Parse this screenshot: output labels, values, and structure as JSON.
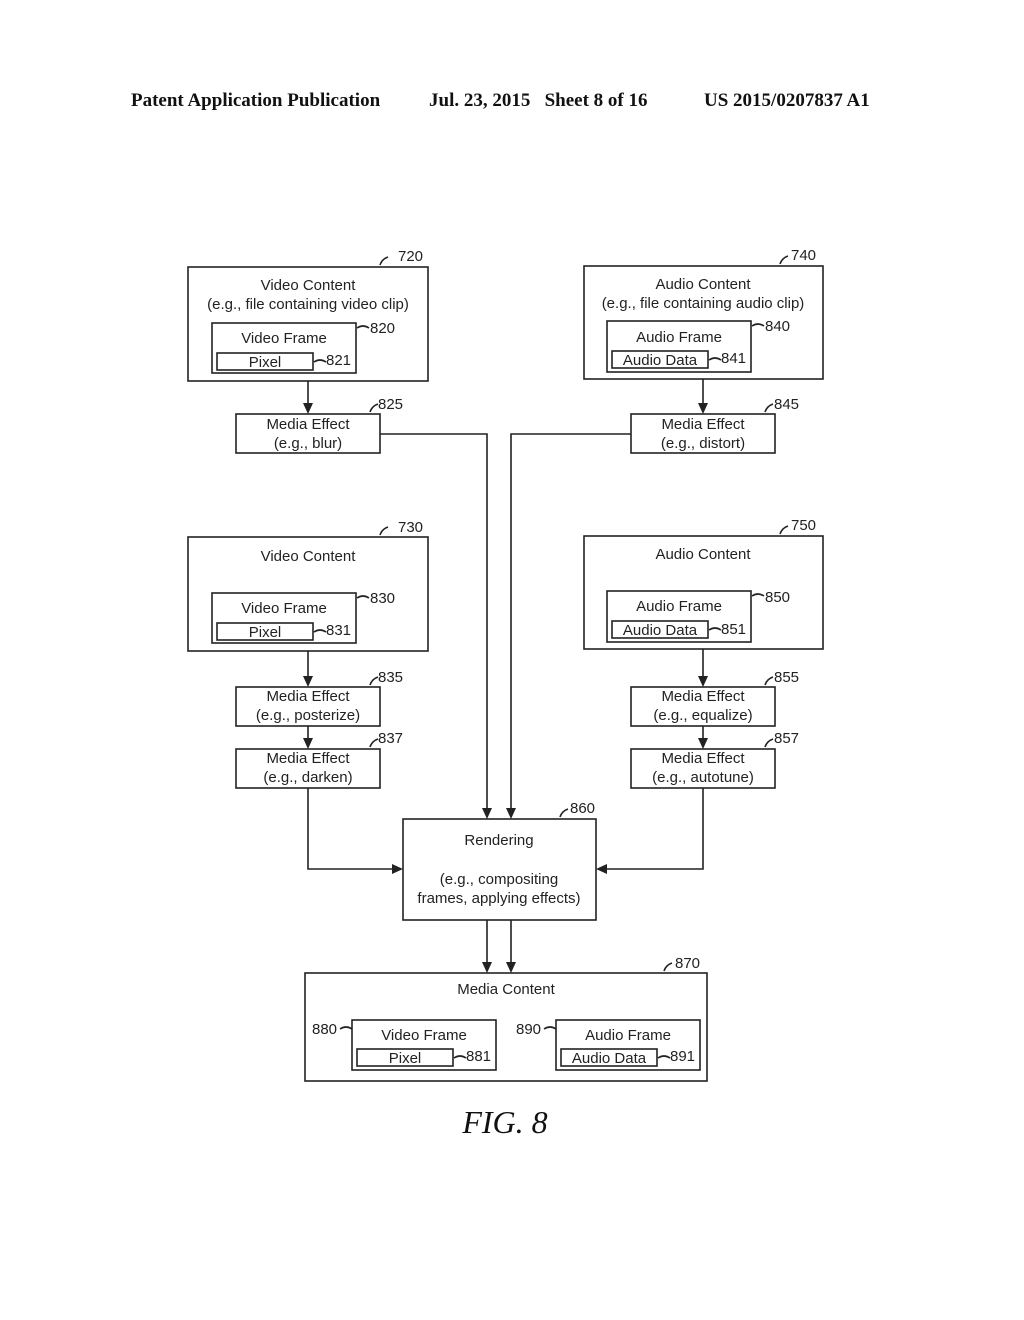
{
  "header": {
    "publication": "Patent Application Publication",
    "date_sheet": "Jul. 23, 2015   Sheet 8 of 16",
    "number": "US 2015/0207837 A1"
  },
  "figure_label": "FIG. 8",
  "nodes": {
    "n720": {
      "ref": "720",
      "line1": "Video Content",
      "line2": "(e.g., file containing video clip)"
    },
    "n820": {
      "ref": "820",
      "label": "Video Frame"
    },
    "n821": {
      "ref": "821",
      "label": "Pixel"
    },
    "n825": {
      "ref": "825",
      "line1": "Media Effect",
      "line2": "(e.g., blur)"
    },
    "n740": {
      "ref": "740",
      "line1": "Audio Content",
      "line2": "(e.g., file containing audio clip)"
    },
    "n840": {
      "ref": "840",
      "label": "Audio Frame"
    },
    "n841": {
      "ref": "841",
      "label": "Audio Data"
    },
    "n845": {
      "ref": "845",
      "line1": "Media Effect",
      "line2": "(e.g., distort)"
    },
    "n730": {
      "ref": "730",
      "line1": "Video Content"
    },
    "n830": {
      "ref": "830",
      "label": "Video Frame"
    },
    "n831": {
      "ref": "831",
      "label": "Pixel"
    },
    "n835": {
      "ref": "835",
      "line1": "Media Effect",
      "line2": "(e.g., posterize)"
    },
    "n837": {
      "ref": "837",
      "line1": "Media Effect",
      "line2": "(e.g., darken)"
    },
    "n750": {
      "ref": "750",
      "line1": "Audio Content"
    },
    "n850": {
      "ref": "850",
      "label": "Audio Frame"
    },
    "n851": {
      "ref": "851",
      "label": "Audio Data"
    },
    "n855": {
      "ref": "855",
      "line1": "Media Effect",
      "line2": "(e.g., equalize)"
    },
    "n857": {
      "ref": "857",
      "line1": "Media Effect",
      "line2": "(e.g., autotune)"
    },
    "n860": {
      "ref": "860",
      "line1": "Rendering",
      "line2": "(e.g., compositing",
      "line3": "frames, applying effects)"
    },
    "n870": {
      "ref": "870",
      "line1": "Media Content"
    },
    "n880": {
      "ref": "880",
      "label": "Video Frame"
    },
    "n881": {
      "ref": "881",
      "label": "Pixel"
    },
    "n890": {
      "ref": "890",
      "label": "Audio Frame"
    },
    "n891": {
      "ref": "891",
      "label": "Audio Data"
    }
  }
}
